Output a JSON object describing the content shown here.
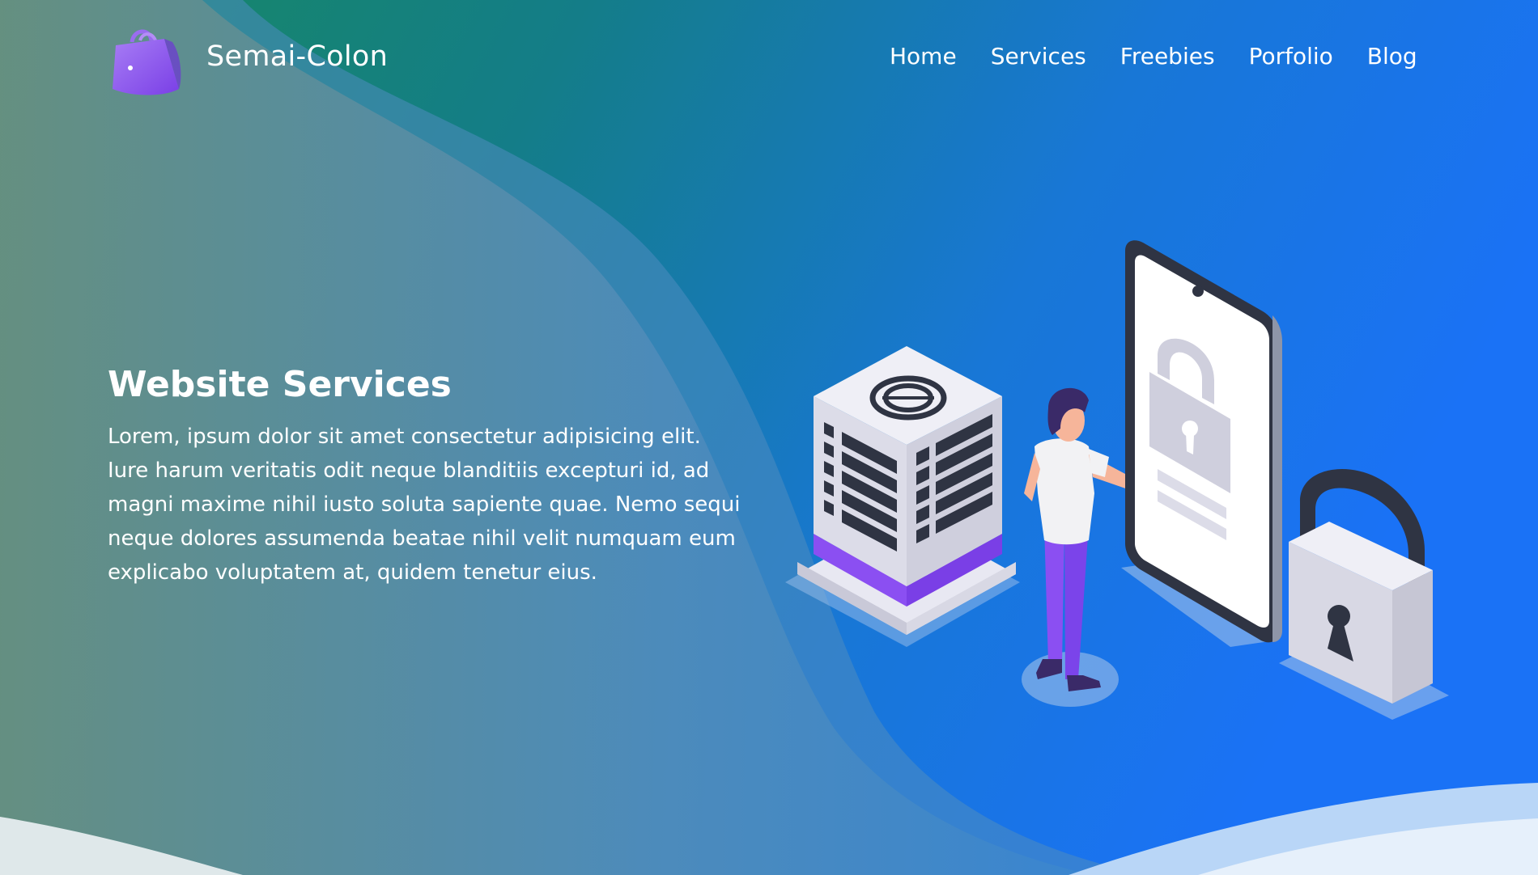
{
  "brand": {
    "name": "Semai-Colon",
    "logo_icon": "shopping-bag-icon"
  },
  "nav": {
    "items": [
      {
        "label": "Home"
      },
      {
        "label": "Services"
      },
      {
        "label": "Freebies"
      },
      {
        "label": "Porfolio"
      },
      {
        "label": "Blog"
      }
    ]
  },
  "hero": {
    "title": "Website Services",
    "description": "Lorem, ipsum dolor sit amet consectetur adipisicing elit. Iure harum veritatis odit neque blanditiis excepturi id, ad magni maxime nihil iusto soluta sapiente quae. Nemo sequi neque dolores assumenda beatae nihil velit numquam eum explicabo voluptatem at, quidem tenetur eius."
  },
  "illustration": {
    "elements": [
      "server-tower-icon",
      "person-figure",
      "smartphone-lock-screen",
      "padlock-icon"
    ]
  },
  "colors": {
    "gradient_green": "#1a8a5a",
    "gradient_blue": "#1872f2",
    "muted_green": "#6a9080",
    "accent_purple": "#8b4ff2",
    "text": "#ffffff"
  }
}
